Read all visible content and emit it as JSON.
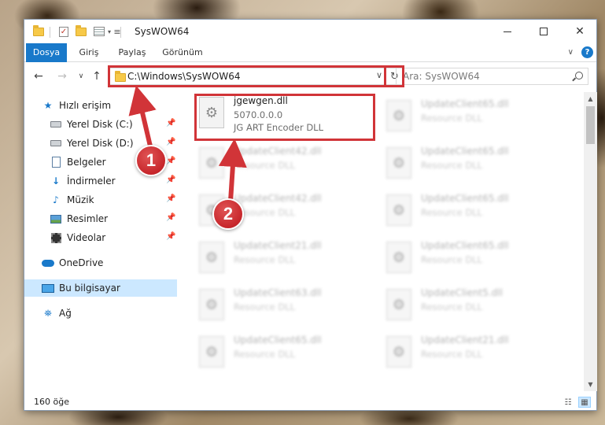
{
  "window": {
    "title": "SysWOW64",
    "controls": {
      "minimize": "",
      "maximize": "",
      "close": "✕"
    }
  },
  "ribbon": {
    "tabs": [
      "Dosya",
      "Giriş",
      "Paylaş",
      "Görünüm"
    ],
    "help": "?"
  },
  "address_bar": {
    "path": "C:\\Windows\\SysWOW64",
    "search_placeholder": "Ara: SysWOW64"
  },
  "nav_pane": {
    "items": [
      {
        "label": "Hızlı erişim",
        "icon": "star-icon"
      },
      {
        "label": "Yerel Disk (C:)",
        "icon": "disk-icon",
        "pinned": true
      },
      {
        "label": "Yerel Disk (D:)",
        "icon": "disk-icon",
        "pinned": true
      },
      {
        "label": "Belgeler",
        "icon": "documents-icon",
        "pinned": true
      },
      {
        "label": "İndirmeler",
        "icon": "download-icon",
        "pinned": true
      },
      {
        "label": "Müzik",
        "icon": "music-icon",
        "pinned": true
      },
      {
        "label": "Resimler",
        "icon": "pictures-icon",
        "pinned": true
      },
      {
        "label": "Videolar",
        "icon": "videos-icon",
        "pinned": true
      },
      {
        "label": "OneDrive",
        "icon": "cloud-icon"
      },
      {
        "label": "Bu bilgisayar",
        "icon": "computer-icon",
        "selected": true
      },
      {
        "label": "Ağ",
        "icon": "network-icon"
      }
    ]
  },
  "files": {
    "highlighted": {
      "name": "jgewgen.dll",
      "version": "5070.0.0.0",
      "description": "JG ART Encoder DLL"
    },
    "left_column": [
      {
        "name": "UpdateClient42.dll",
        "description": "Resource DLL"
      },
      {
        "name": "UpdateClient42.dll",
        "description": "Resource DLL"
      },
      {
        "name": "UpdateClient21.dll",
        "description": "Resource DLL"
      },
      {
        "name": "UpdateClient63.dll",
        "description": "Resource DLL"
      },
      {
        "name": "UpdateClient65.dll",
        "description": "Resource DLL"
      }
    ],
    "right_column": [
      {
        "name": "UpdateClient65.dll",
        "description": "Resource DLL"
      },
      {
        "name": "UpdateClient65.dll",
        "description": "Resource DLL"
      },
      {
        "name": "UpdateClient65.dll",
        "description": "Resource DLL"
      },
      {
        "name": "UpdateClient65.dll",
        "description": "Resource DLL"
      },
      {
        "name": "UpdateClient5.dll",
        "description": "Resource DLL"
      },
      {
        "name": "UpdateClient21.dll",
        "description": "Resource DLL"
      }
    ]
  },
  "status_bar": {
    "item_count": "160 öğe"
  },
  "annotations": {
    "step1": "1",
    "step2": "2",
    "color": "#d13438"
  }
}
